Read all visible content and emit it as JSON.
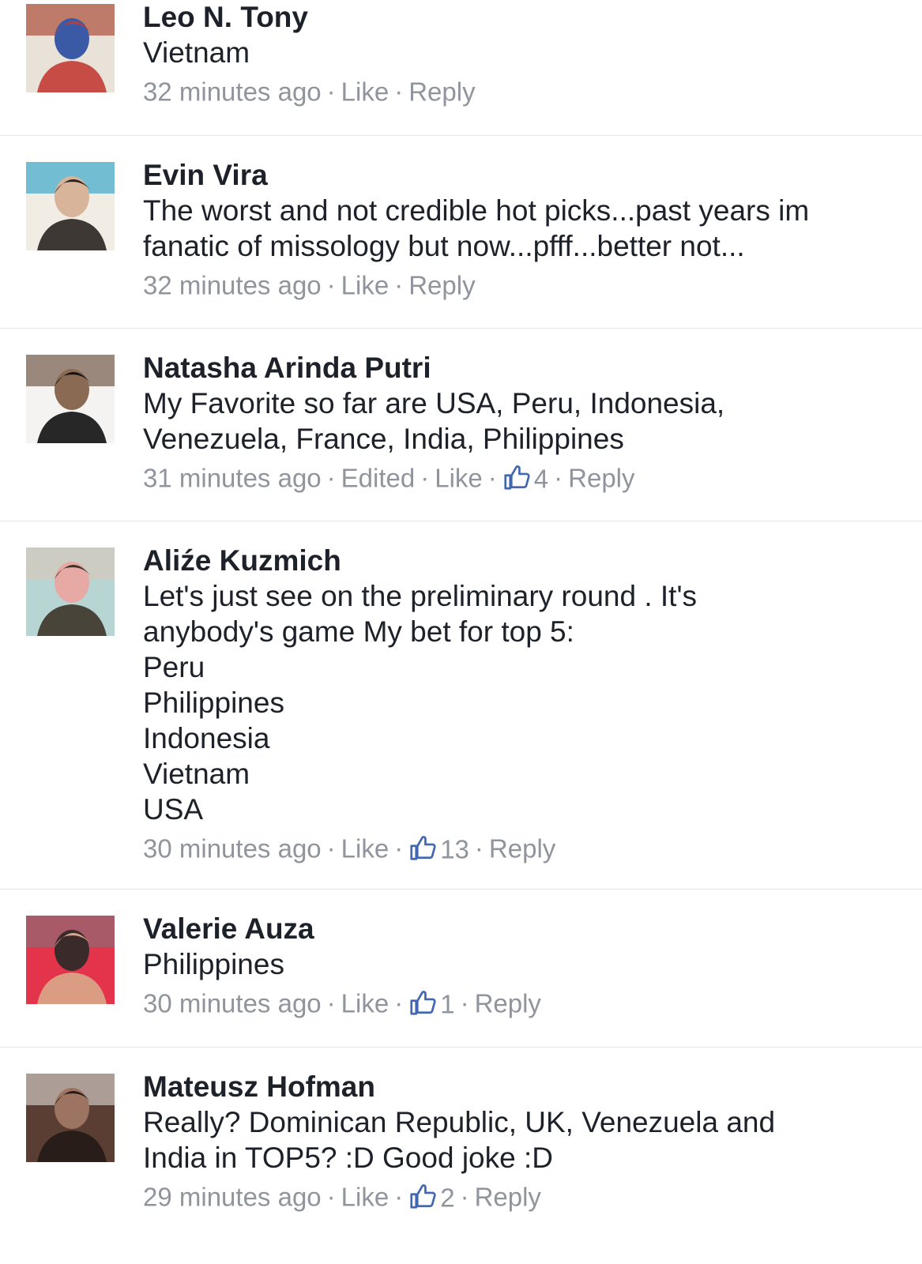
{
  "comments": [
    {
      "name": "Leo N. Tony",
      "text": "Vietnam",
      "time": "32 minutes ago",
      "edited": "",
      "like_label": "Like",
      "likes": "",
      "reply_label": "Reply",
      "avatar_colors": [
        "#a8432f",
        "#e9e2d8",
        "#c23c35",
        "#3a5aa6"
      ]
    },
    {
      "name": "Evin Vira",
      "text": "The worst and not credible hot picks...past years im\nfanatic of missology but now...pfff...better not...",
      "time": "32 minutes ago",
      "edited": "",
      "like_label": "Like",
      "likes": "",
      "reply_label": "Reply",
      "avatar_colors": [
        "#2ea3c6",
        "#f1ede4",
        "#2a2420",
        "#d8b59a"
      ]
    },
    {
      "name": "Natasha Arinda Putri",
      "text": "My Favorite so far are USA, Peru, Indonesia,\nVenezuela, France, India, Philippines",
      "time": "31 minutes ago",
      "edited": "Edited",
      "like_label": "Like",
      "likes": "4",
      "reply_label": "Reply",
      "avatar_colors": [
        "#6a4f3d",
        "#f4f3f1",
        "#111111",
        "#8a6a52"
      ]
    },
    {
      "name": "Aliźe Kuzmich",
      "text": "Let's just see on the preliminary round . It's\nanybody's game My bet for top 5:\nPeru\nPhilippines\nIndonesia\nVietnam\nUSA",
      "time": "30 minutes ago",
      "edited": "",
      "like_label": "Like",
      "likes": "13",
      "reply_label": "Reply",
      "avatar_colors": [
        "#d9c6b8",
        "#b7d6d3",
        "#3d3428",
        "#e6a9a4"
      ]
    },
    {
      "name": "Valerie Auza",
      "text": "Philippines",
      "time": "30 minutes ago",
      "edited": "",
      "like_label": "Like",
      "likes": "1",
      "reply_label": "Reply",
      "avatar_colors": [
        "#8a6f78",
        "#e3344c",
        "#d9a78b",
        "#3b2a2a"
      ]
    },
    {
      "name": "Mateusz Hofman",
      "text": "Really? Dominican Republic, UK, Venezuela and\nIndia in TOP5? :D Good joke :D",
      "time": "29 minutes ago",
      "edited": "",
      "like_label": "Like",
      "likes": "2",
      "reply_label": "Reply",
      "avatar_colors": [
        "#d8d2cc",
        "#5a3d33",
        "#241a17",
        "#9c7461"
      ]
    }
  ],
  "colors": {
    "name": "#1d2129",
    "meta": "#90949c",
    "like_icon": "#4267b2",
    "divider": "#e5e6e9"
  },
  "icons": {
    "like": "thumbs-up-icon"
  }
}
